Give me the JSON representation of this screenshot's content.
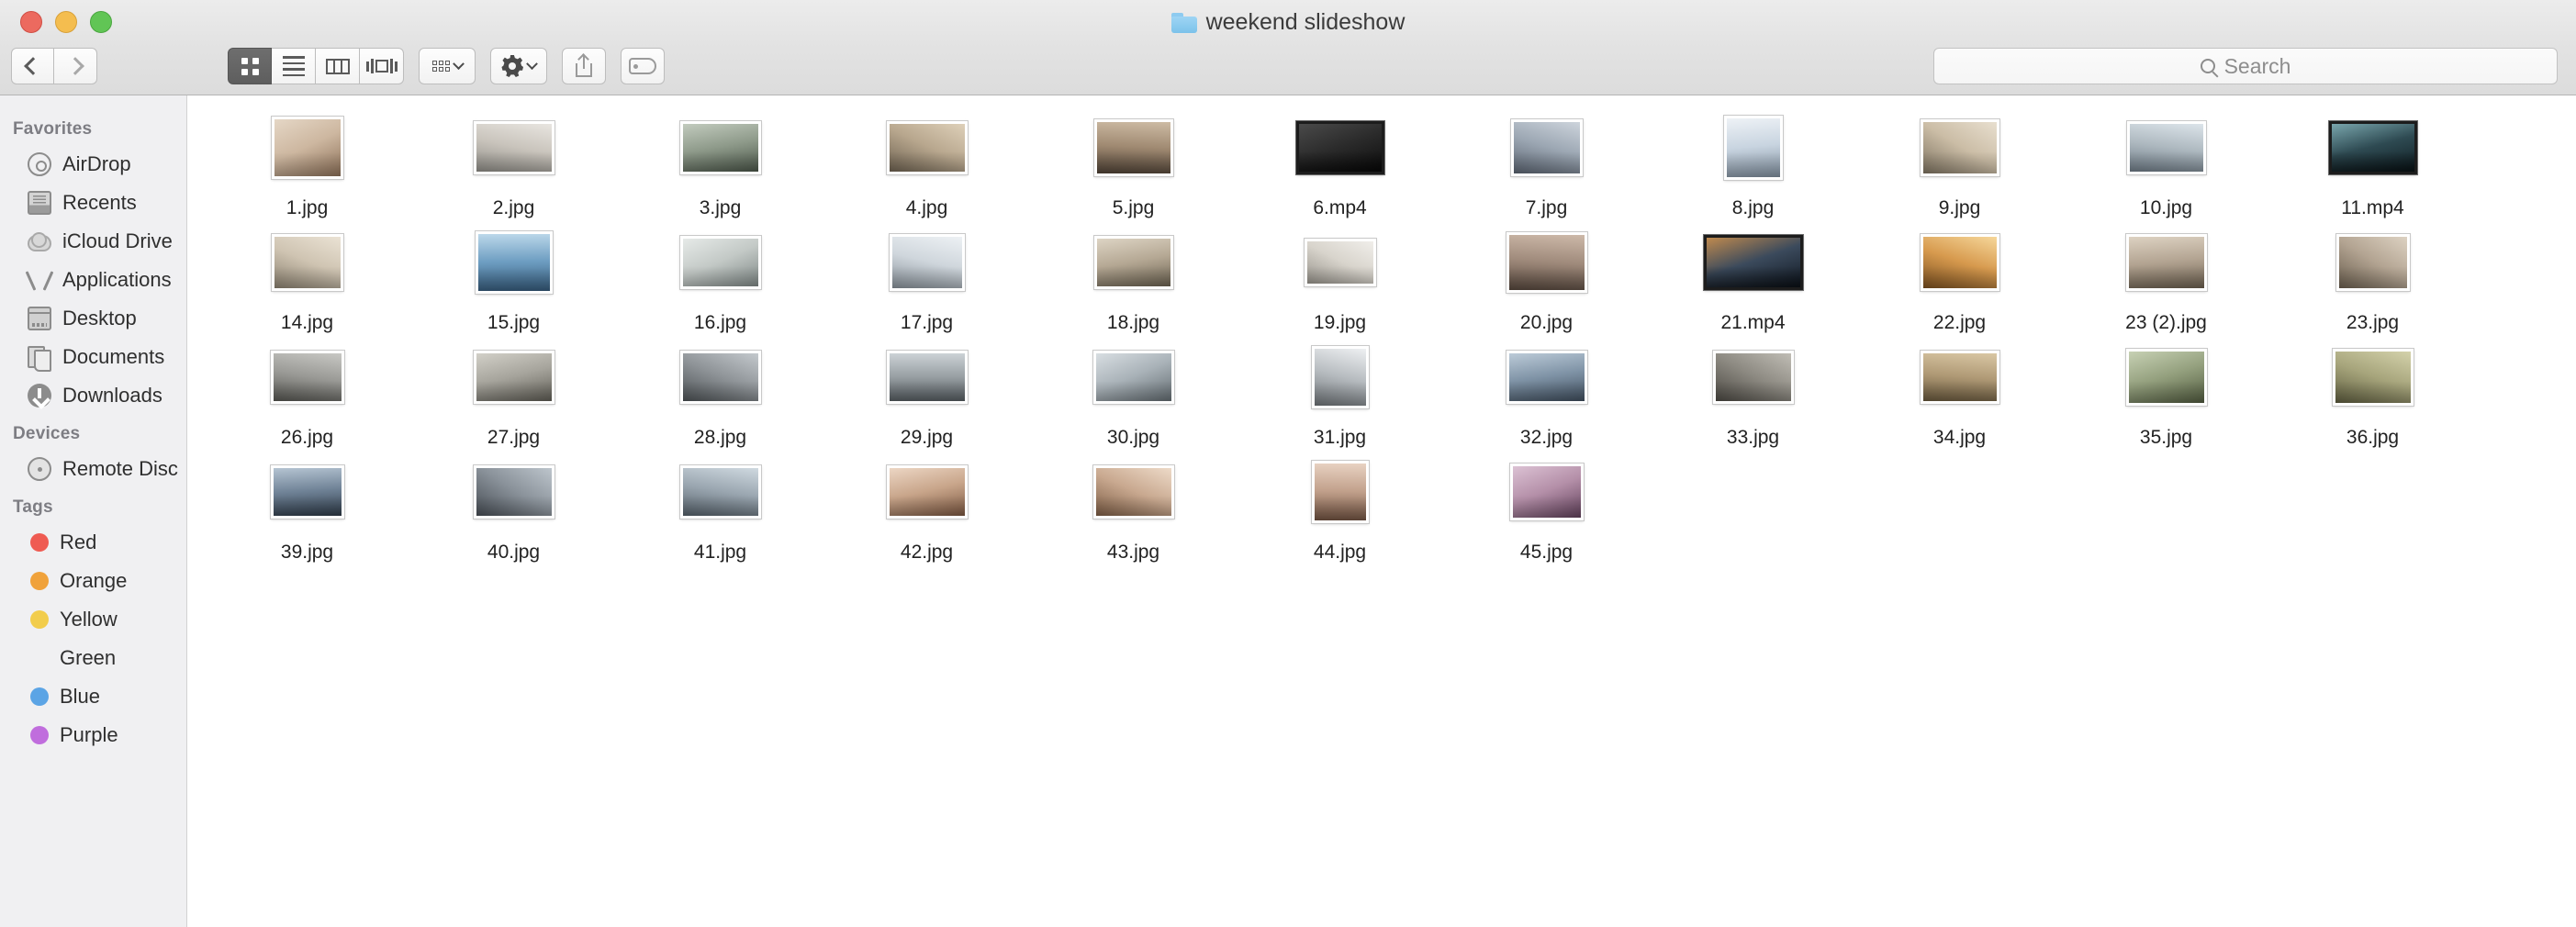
{
  "window": {
    "title": "weekend slideshow",
    "folder_icon": "folder-icon",
    "traffic_lights": [
      "close",
      "minimize",
      "zoom"
    ],
    "colors": {
      "close": "#ec6a5f",
      "minimize": "#f4bd4f",
      "zoom": "#61c555",
      "folder": "#8ecbf0"
    }
  },
  "toolbar": {
    "back_label": "Back",
    "forward_label": "Forward",
    "view_modes": [
      {
        "name": "icon-view",
        "label": "Icon View",
        "selected": true
      },
      {
        "name": "list-view",
        "label": "List View",
        "selected": false
      },
      {
        "name": "column-view",
        "label": "Column View",
        "selected": false
      },
      {
        "name": "coverflow-view",
        "label": "Cover Flow View",
        "selected": false
      }
    ],
    "arrange_label": "Arrange By",
    "action_label": "Action",
    "share_label": "Share",
    "tags_label": "Edit Tags"
  },
  "search": {
    "placeholder": "Search",
    "value": "",
    "icon": "search-icon"
  },
  "sidebar": {
    "sections": [
      {
        "title": "Favorites",
        "items": [
          {
            "label": "AirDrop",
            "icon": "airdrop-icon"
          },
          {
            "label": "Recents",
            "icon": "recents-icon"
          },
          {
            "label": "iCloud Drive",
            "icon": "icloud-icon"
          },
          {
            "label": "Applications",
            "icon": "applications-icon"
          },
          {
            "label": "Desktop",
            "icon": "desktop-icon"
          },
          {
            "label": "Documents",
            "icon": "documents-icon"
          },
          {
            "label": "Downloads",
            "icon": "downloads-icon"
          }
        ]
      },
      {
        "title": "Devices",
        "items": [
          {
            "label": "Remote Disc",
            "icon": "disc-icon"
          }
        ]
      },
      {
        "title": "Tags",
        "items": [
          {
            "label": "Red",
            "icon": "tag-dot",
            "color": "#ef5b52"
          },
          {
            "label": "Orange",
            "icon": "tag-dot",
            "color": "#f0a23b"
          },
          {
            "label": "Yellow",
            "icon": "tag-dot",
            "color": "#f2cd4c"
          },
          {
            "label": "Green",
            "icon": "tag-dot",
            "color": "#6fc martin"
          },
          {
            "label": "Blue",
            "icon": "tag-dot",
            "color": "#5ba4e5"
          },
          {
            "label": "Purple",
            "icon": "tag-dot",
            "color": "#c06ddd"
          }
        ]
      }
    ]
  },
  "files": [
    {
      "name": "1.jpg",
      "kind": "image",
      "w": 78,
      "h": 68,
      "c1": "#cdb7a0",
      "c2": "#8b6f57",
      "c3": "#e5d7c6"
    },
    {
      "name": "2.jpg",
      "kind": "image",
      "w": 88,
      "h": 58,
      "c1": "#c9c4bc",
      "c2": "#8d8b85",
      "c3": "#e8e5e0"
    },
    {
      "name": "3.jpg",
      "kind": "image",
      "w": 88,
      "h": 58,
      "c1": "#8e9a8a",
      "c2": "#4a5548",
      "c3": "#c2cbbe"
    },
    {
      "name": "4.jpg",
      "kind": "image",
      "w": 88,
      "h": 58,
      "c1": "#b8a78e",
      "c2": "#6d6150",
      "c3": "#ded0b9"
    },
    {
      "name": "5.jpg",
      "kind": "image",
      "w": 86,
      "h": 62,
      "c1": "#a08a72",
      "c2": "#4e4135",
      "c3": "#cdbba4"
    },
    {
      "name": "6.mp4",
      "kind": "video",
      "w": 96,
      "h": 58,
      "c1": "#2b2b2b",
      "c2": "#0d0d0d",
      "c3": "#4a4a4a"
    },
    {
      "name": "7.jpg",
      "kind": "image",
      "w": 78,
      "h": 62,
      "c1": "#9ca7b3",
      "c2": "#5a6370",
      "c3": "#cdd4dc"
    },
    {
      "name": "8.jpg",
      "kind": "image",
      "w": 64,
      "h": 70,
      "c1": "#c8d4e0",
      "c2": "#7e8d9c",
      "c3": "#eef2f6"
    },
    {
      "name": "9.jpg",
      "kind": "image",
      "w": 86,
      "h": 62,
      "c1": "#cbbda6",
      "c2": "#7d7260",
      "c3": "#e8dfcf"
    },
    {
      "name": "10.jpg",
      "kind": "image",
      "w": 86,
      "h": 58,
      "c1": "#aeb9c0",
      "c2": "#6d7a85",
      "c3": "#dce4ea"
    },
    {
      "name": "11.mp4",
      "kind": "video",
      "w": 96,
      "h": 58,
      "c1": "#2e4a52",
      "c2": "#0f1d22",
      "c3": "#79a6ad"
    },
    {
      "name": "14.jpg",
      "kind": "image",
      "w": 78,
      "h": 62,
      "c1": "#cfc4b2",
      "c2": "#8a806f",
      "c3": "#eae2d4"
    },
    {
      "name": "15.jpg",
      "kind": "image",
      "w": 84,
      "h": 68,
      "c1": "#6e9ec2",
      "c2": "#355a7a",
      "c3": "#bcd8ea"
    },
    {
      "name": "16.jpg",
      "kind": "image",
      "w": 88,
      "h": 58,
      "c1": "#c3c9c6",
      "c2": "#7e8785",
      "c3": "#e6eae8"
    },
    {
      "name": "17.jpg",
      "kind": "image",
      "w": 82,
      "h": 62,
      "c1": "#cfd6dc",
      "c2": "#868f97",
      "c3": "#edf1f4"
    },
    {
      "name": "18.jpg",
      "kind": "image",
      "w": 86,
      "h": 58,
      "c1": "#b5a894",
      "c2": "#6a6150",
      "c3": "#ddd4c4"
    },
    {
      "name": "19.jpg",
      "kind": "image",
      "w": 78,
      "h": 52,
      "c1": "#d8d4cc",
      "c2": "#96928a",
      "c3": "#f0eeea"
    },
    {
      "name": "20.jpg",
      "kind": "image",
      "w": 88,
      "h": 66,
      "c1": "#a08b7c",
      "c2": "#55463c",
      "c3": "#cdb9a9"
    },
    {
      "name": "21.mp4",
      "kind": "video",
      "w": 108,
      "h": 60,
      "c1": "#3b4a5c",
      "c2": "#121a24",
      "c3": "#c08a4e"
    },
    {
      "name": "22.jpg",
      "kind": "image",
      "w": 86,
      "h": 62,
      "c1": "#d79a4e",
      "c2": "#7a4f20",
      "c3": "#f6d79a"
    },
    {
      "name": "23 (2).jpg",
      "kind": "image",
      "w": 88,
      "h": 62,
      "c1": "#b3a492",
      "c2": "#6a5e4e",
      "c3": "#ddd2c2"
    },
    {
      "name": "23.jpg",
      "kind": "image",
      "w": 80,
      "h": 62,
      "c1": "#b3a492",
      "c2": "#6a5e4e",
      "c3": "#ddd2c2"
    },
    {
      "name": "26.jpg",
      "kind": "image",
      "w": 80,
      "h": 58,
      "c1": "#9a9a96",
      "c2": "#555550",
      "c3": "#c8c8c4"
    },
    {
      "name": "27.jpg",
      "kind": "image",
      "w": 88,
      "h": 58,
      "c1": "#a6a49c",
      "c2": "#5e5c54",
      "c3": "#d2d0c8"
    },
    {
      "name": "28.jpg",
      "kind": "image",
      "w": 88,
      "h": 58,
      "c1": "#8f9498",
      "c2": "#4c5154",
      "c3": "#c4c9cd"
    },
    {
      "name": "29.jpg",
      "kind": "image",
      "w": 88,
      "h": 58,
      "c1": "#99a0a4",
      "c2": "#555c60",
      "c3": "#ccd2d6"
    },
    {
      "name": "30.jpg",
      "kind": "image",
      "w": 88,
      "h": 58,
      "c1": "#a9b2b8",
      "c2": "#626b70",
      "c3": "#d8dee2"
    },
    {
      "name": "31.jpg",
      "kind": "image",
      "w": 62,
      "h": 68,
      "c1": "#b7bcc0",
      "c2": "#6d7276",
      "c3": "#eef0f2"
    },
    {
      "name": "32.jpg",
      "kind": "image",
      "w": 88,
      "h": 58,
      "c1": "#7f93a6",
      "c2": "#3f4d5c",
      "c3": "#bccbd8"
    },
    {
      "name": "33.jpg",
      "kind": "image",
      "w": 88,
      "h": 58,
      "c1": "#8d8a82",
      "c2": "#4b4842",
      "c3": "#c0bdb5"
    },
    {
      "name": "34.jpg",
      "kind": "image",
      "w": 86,
      "h": 58,
      "c1": "#b09a76",
      "c2": "#67573c",
      "c3": "#d9c7a4"
    },
    {
      "name": "35.jpg",
      "kind": "image",
      "w": 88,
      "h": 62,
      "c1": "#94a07e",
      "c2": "#505a3e",
      "c3": "#c7d1b4"
    },
    {
      "name": "36.jpg",
      "kind": "image",
      "w": 88,
      "h": 62,
      "c1": "#a7a57c",
      "c2": "#5d5c3e",
      "c3": "#d4d2ab"
    },
    {
      "name": "39.jpg",
      "kind": "image",
      "w": 80,
      "h": 58,
      "c1": "#6f8296",
      "c2": "#2e3a47",
      "c3": "#b5c4d2"
    },
    {
      "name": "40.jpg",
      "kind": "image",
      "w": 88,
      "h": 58,
      "c1": "#8a929a",
      "c2": "#474d54",
      "c3": "#bdc5cc"
    },
    {
      "name": "41.jpg",
      "kind": "image",
      "w": 88,
      "h": 58,
      "c1": "#9aa6b0",
      "c2": "#545f68",
      "c3": "#cfd9e0"
    },
    {
      "name": "42.jpg",
      "kind": "image",
      "w": 88,
      "h": 58,
      "c1": "#c8a58a",
      "c2": "#7a5640",
      "c3": "#ecd6c4"
    },
    {
      "name": "43.jpg",
      "kind": "image",
      "w": 88,
      "h": 58,
      "c1": "#c9a990",
      "c2": "#7c5c44",
      "c3": "#eddac8"
    },
    {
      "name": "44.jpg",
      "kind": "image",
      "w": 62,
      "h": 68,
      "c1": "#c2a18c",
      "c2": "#6f5140",
      "c3": "#e8d2c2"
    },
    {
      "name": "45.jpg",
      "kind": "image",
      "w": 80,
      "h": 62,
      "c1": "#b48fa8",
      "c2": "#60405a",
      "c3": "#dcc2d4"
    }
  ]
}
